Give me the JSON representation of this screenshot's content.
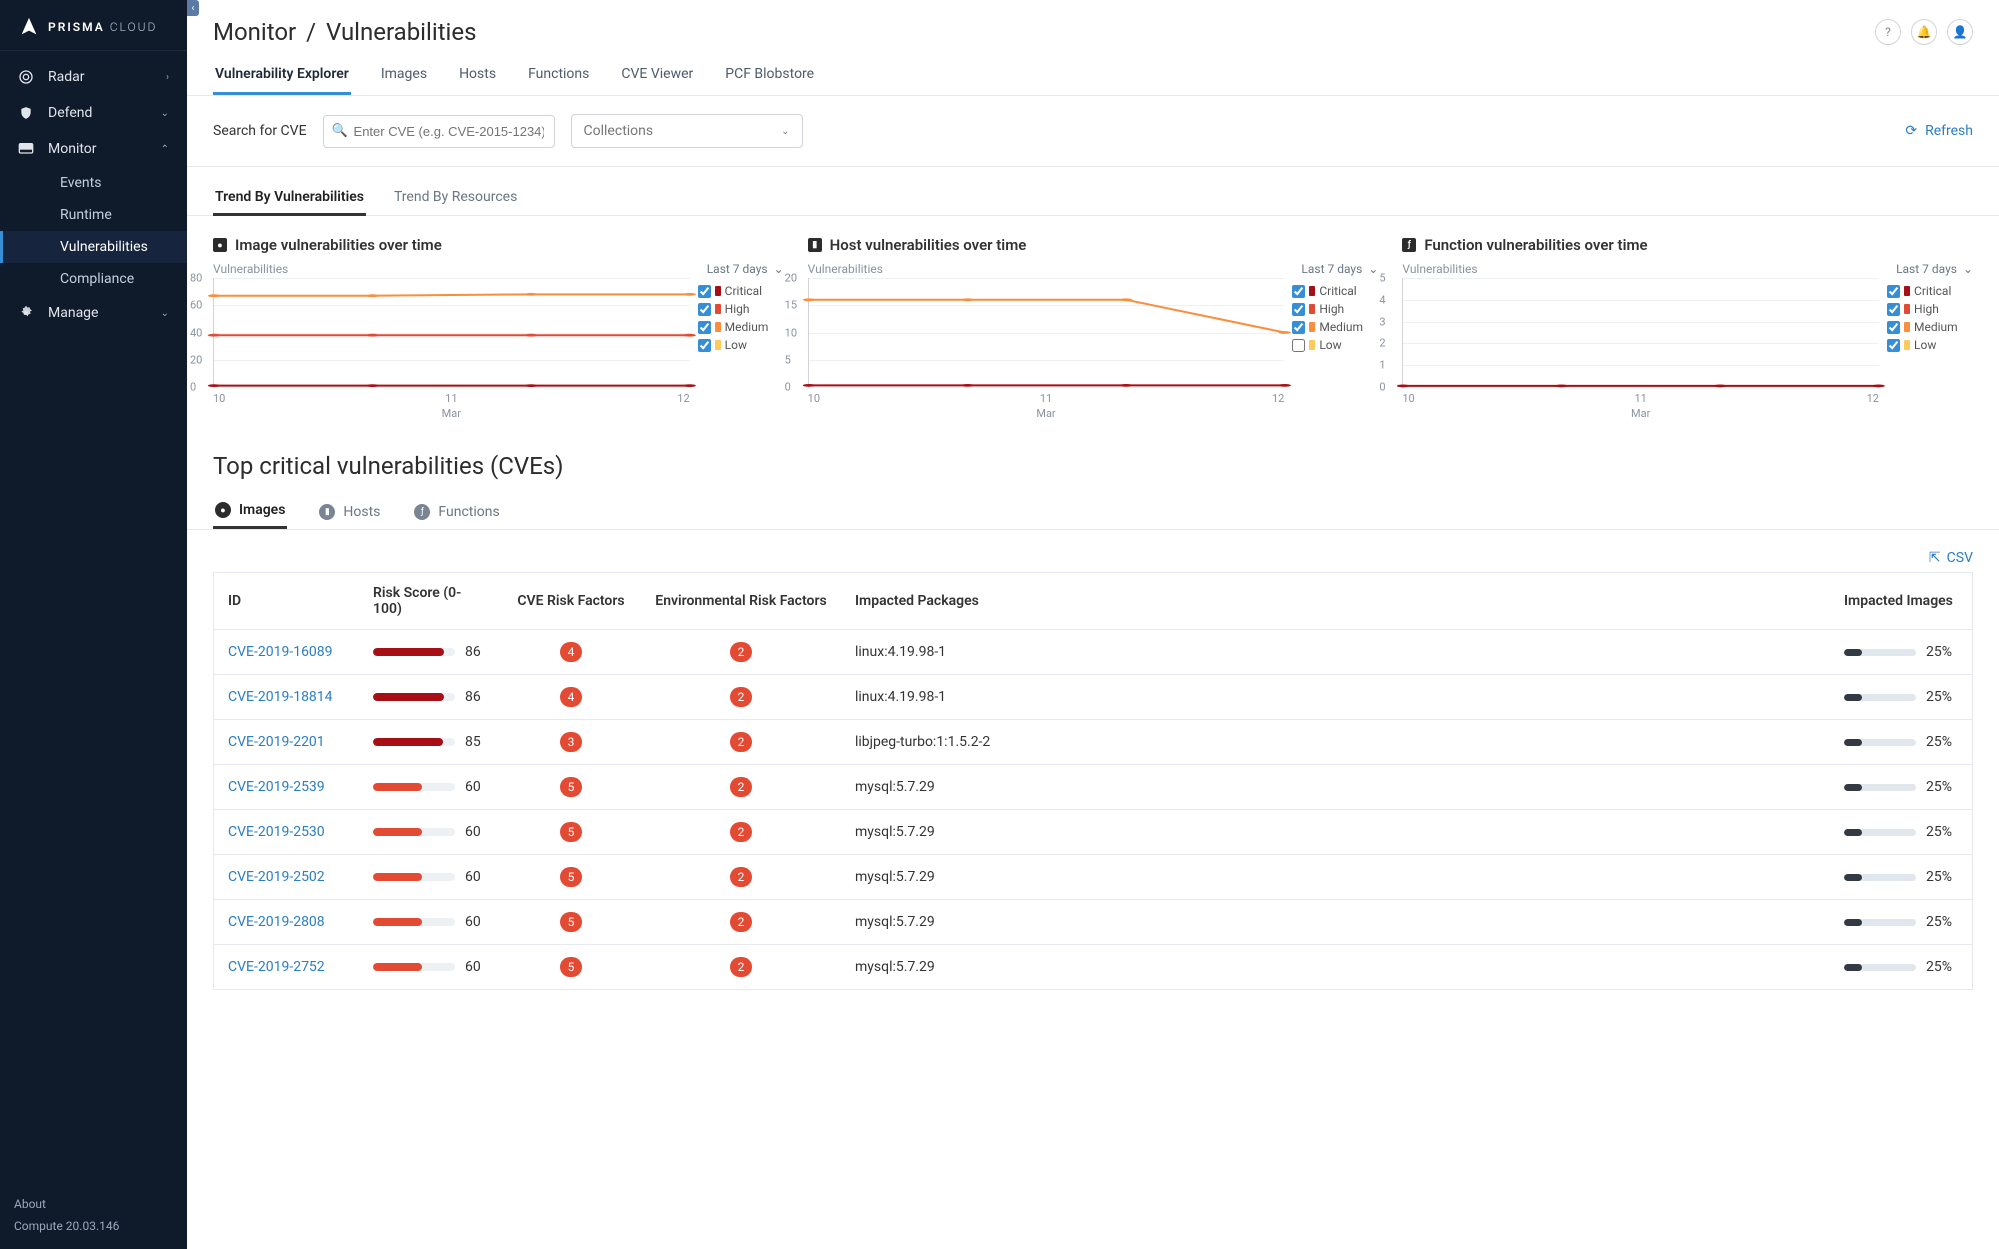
{
  "brand": {
    "name": "PRISMA",
    "suffix": "CLOUD"
  },
  "sidebar": {
    "items": [
      {
        "label": "Radar",
        "icon": "radar"
      },
      {
        "label": "Defend",
        "icon": "shield"
      },
      {
        "label": "Monitor",
        "icon": "screen",
        "expanded": true
      },
      {
        "label": "Manage",
        "icon": "gear"
      }
    ],
    "monitor_sub": [
      "Events",
      "Runtime",
      "Vulnerabilities",
      "Compliance"
    ],
    "active_sub": "Vulnerabilities"
  },
  "sidebar_footer": {
    "about": "About",
    "version": "Compute 20.03.146"
  },
  "page": {
    "crumb1": "Monitor",
    "crumb2": "Vulnerabilities"
  },
  "top_icons": [
    "help-icon",
    "bell-icon",
    "user-icon"
  ],
  "primary_tabs": [
    "Vulnerability Explorer",
    "Images",
    "Hosts",
    "Functions",
    "CVE Viewer",
    "PCF Blobstore"
  ],
  "primary_active": "Vulnerability Explorer",
  "toolbar": {
    "search_label": "Search for CVE",
    "search_placeholder": "Enter CVE (e.g. CVE-2015-1234)",
    "collections_label": "Collections",
    "refresh": "Refresh"
  },
  "trend_tabs": [
    "Trend By Vulnerabilities",
    "Trend By Resources"
  ],
  "trend_active": "Trend By Vulnerabilities",
  "severities": [
    {
      "key": "critical",
      "label": "Critical",
      "color": "#a50f15"
    },
    {
      "key": "high",
      "label": "High",
      "color": "#e34a33"
    },
    {
      "key": "medium",
      "label": "Medium",
      "color": "#fb8d3c"
    },
    {
      "key": "low",
      "label": "Low",
      "color": "#feca5b"
    }
  ],
  "range_label": "Last 7 days",
  "ylabel": "Vulnerabilities",
  "xmonth": "Mar",
  "chart_data": [
    {
      "title": "Image vulnerabilities over time",
      "icon": "●",
      "yticks": [
        0,
        20,
        40,
        60,
        80
      ],
      "ymax": 80,
      "xticks": [
        "10",
        "11",
        "12"
      ],
      "legend_checked": {
        "critical": true,
        "high": true,
        "medium": true,
        "low": true
      },
      "series": [
        {
          "name": "medium",
          "color": "#fb8d3c",
          "values": [
            67,
            67,
            68,
            68
          ]
        },
        {
          "name": "high",
          "color": "#e34a33",
          "values": [
            38,
            38,
            38,
            38
          ]
        },
        {
          "name": "critical",
          "color": "#a50f15",
          "values": [
            1,
            1,
            1,
            1
          ]
        }
      ]
    },
    {
      "title": "Host vulnerabilities over time",
      "icon": "▮",
      "yticks": [
        0,
        5,
        10,
        15,
        20
      ],
      "ymax": 20,
      "xticks": [
        "10",
        "11",
        "12"
      ],
      "legend_checked": {
        "critical": true,
        "high": true,
        "medium": true,
        "low": false
      },
      "series": [
        {
          "name": "medium",
          "color": "#fb8d3c",
          "values": [
            16,
            16,
            16,
            10
          ]
        },
        {
          "name": "critical",
          "color": "#a50f15",
          "values": [
            0.3,
            0.3,
            0.3,
            0.3
          ]
        }
      ]
    },
    {
      "title": "Function vulnerabilities over time",
      "icon": "ƒ",
      "yticks": [
        0,
        1,
        2,
        3,
        4,
        5
      ],
      "ymax": 5,
      "xticks": [
        "10",
        "11",
        "12"
      ],
      "legend_checked": {
        "critical": true,
        "high": true,
        "medium": true,
        "low": true
      },
      "series": [
        {
          "name": "critical",
          "color": "#a50f15",
          "values": [
            0.05,
            0.05,
            0.05,
            0.05
          ]
        }
      ]
    }
  ],
  "cve_section_title": "Top critical vulnerabilities (CVEs)",
  "scope_tabs": [
    "Images",
    "Hosts",
    "Functions"
  ],
  "scope_active": "Images",
  "csv_label": "CSV",
  "table": {
    "headers": [
      "ID",
      "Risk Score (0-100)",
      "CVE Risk Factors",
      "Environmental Risk Factors",
      "Impacted Packages",
      "Impacted Images"
    ],
    "rows": [
      {
        "id": "CVE-2019-16089",
        "risk": 86,
        "riskColor": "#a50f15",
        "cverf": 4,
        "envrf": 2,
        "pkg": "linux:4.19.98-1",
        "img_pct": "25%",
        "img_fill": 25
      },
      {
        "id": "CVE-2019-18814",
        "risk": 86,
        "riskColor": "#a50f15",
        "cverf": 4,
        "envrf": 2,
        "pkg": "linux:4.19.98-1",
        "img_pct": "25%",
        "img_fill": 25
      },
      {
        "id": "CVE-2019-2201",
        "risk": 85,
        "riskColor": "#a50f15",
        "cverf": 3,
        "envrf": 2,
        "pkg": "libjpeg-turbo:1:1.5.2-2",
        "img_pct": "25%",
        "img_fill": 25
      },
      {
        "id": "CVE-2019-2539",
        "risk": 60,
        "riskColor": "#e34a33",
        "cverf": 5,
        "envrf": 2,
        "pkg": "mysql:5.7.29",
        "img_pct": "25%",
        "img_fill": 25
      },
      {
        "id": "CVE-2019-2530",
        "risk": 60,
        "riskColor": "#e34a33",
        "cverf": 5,
        "envrf": 2,
        "pkg": "mysql:5.7.29",
        "img_pct": "25%",
        "img_fill": 25
      },
      {
        "id": "CVE-2019-2502",
        "risk": 60,
        "riskColor": "#e34a33",
        "cverf": 5,
        "envrf": 2,
        "pkg": "mysql:5.7.29",
        "img_pct": "25%",
        "img_fill": 25
      },
      {
        "id": "CVE-2019-2808",
        "risk": 60,
        "riskColor": "#e34a33",
        "cverf": 5,
        "envrf": 2,
        "pkg": "mysql:5.7.29",
        "img_pct": "25%",
        "img_fill": 25
      },
      {
        "id": "CVE-2019-2752",
        "risk": 60,
        "riskColor": "#e34a33",
        "cverf": 5,
        "envrf": 2,
        "pkg": "mysql:5.7.29",
        "img_pct": "25%",
        "img_fill": 25
      }
    ]
  }
}
